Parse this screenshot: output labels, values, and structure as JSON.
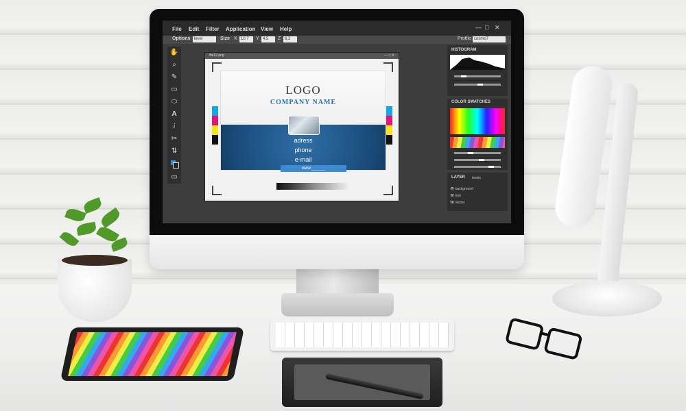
{
  "menu": [
    "File",
    "Edit",
    "Filter",
    "Application",
    "View",
    "Help"
  ],
  "window_controls": [
    "—",
    "□",
    "✕"
  ],
  "options_bar": {
    "options_label": "Options",
    "options_value": "level",
    "size_label": "Size",
    "x_label": "X",
    "x_value": "10,7",
    "y_label": "Y",
    "y_value": "4,5",
    "z_label": "Z",
    "z_value": "8,2",
    "profile_label": "Profile",
    "profile_value": "cosmo7"
  },
  "tools": [
    "hand-icon",
    "zoom-icon",
    "brush-icon",
    "rectangle-icon",
    "ellipse-icon",
    "text-icon",
    "italic-text-icon",
    "scissors-icon",
    "swap-icon",
    "color-swatch-icon",
    "gradient-icon"
  ],
  "document": {
    "title": "file12.png",
    "logo": "LOGO",
    "company": "COMPANY NAME",
    "address": "adress",
    "phone": "phone",
    "email": "e-mail",
    "www": "www.______"
  },
  "panels": {
    "histogram_title": "HISTOGRAM",
    "swatches_title": "COLOR SWATCHES",
    "layer_title": "LAYER",
    "layer_mode": "levels",
    "layers": [
      "background",
      "text",
      "vector"
    ]
  },
  "colors": {
    "accent_blue": "#2c74b4",
    "card_band": "#1b4f80",
    "screen_bg": "#3d3d3d"
  }
}
